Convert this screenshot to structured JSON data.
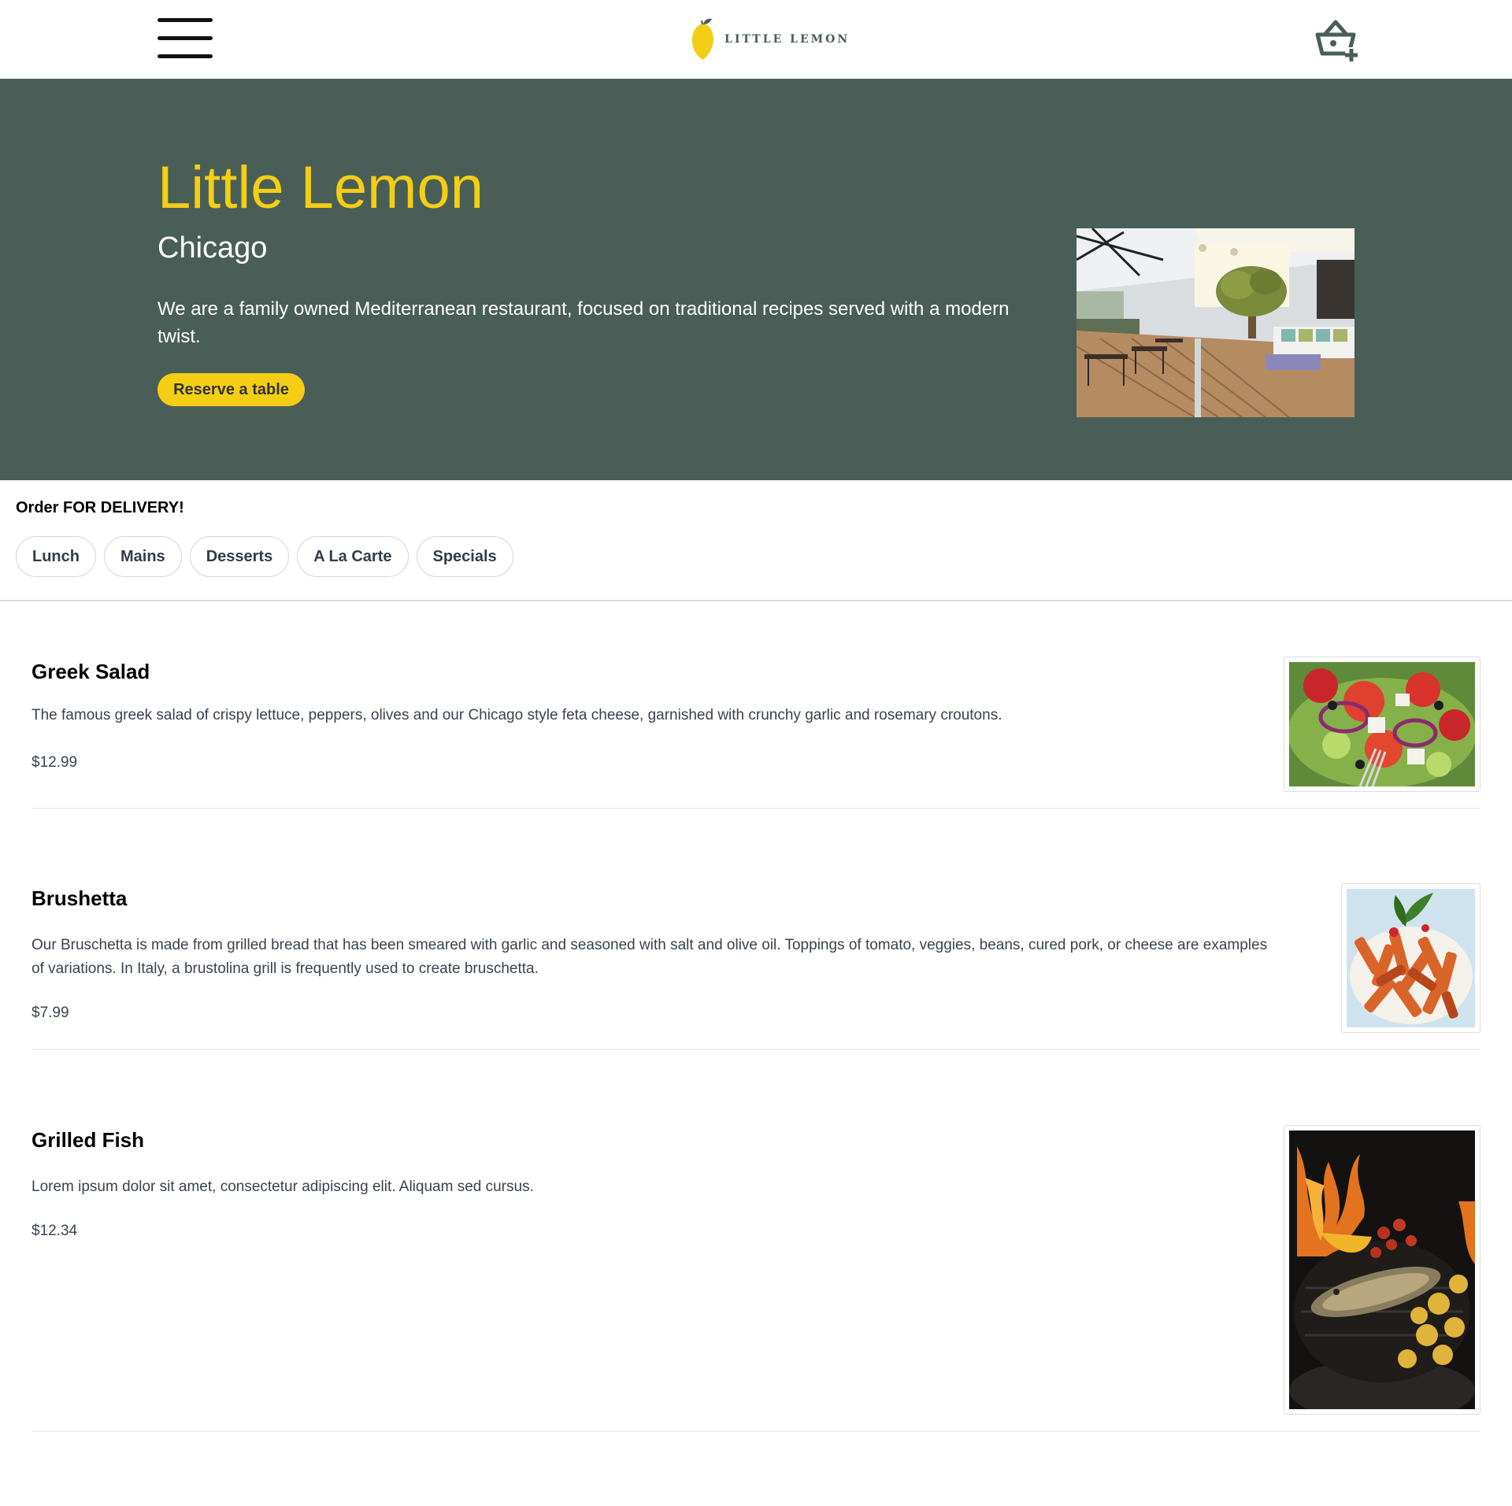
{
  "brand": {
    "logo_text": "LITTLE LEMON"
  },
  "hero": {
    "title": "Little Lemon",
    "subtitle": "Chicago",
    "description": "We are a family owned Mediterranean restaurant, focused on traditional recipes served with a modern twist.",
    "reserve_label": "Reserve a table"
  },
  "delivery": {
    "title": "Order FOR DELIVERY!",
    "categories": [
      "Lunch",
      "Mains",
      "Desserts",
      "A La Carte",
      "Specials"
    ]
  },
  "menu": [
    {
      "name": "Greek Salad",
      "description": "The famous greek salad of crispy lettuce, peppers, olives and our Chicago style feta cheese, garnished with crunchy garlic and rosemary croutons.",
      "price": "$12.99"
    },
    {
      "name": "Brushetta",
      "description": "Our Bruschetta is made from grilled bread that has been smeared with garlic and seasoned with salt and olive oil. Toppings of tomato, veggies, beans, cured pork, or cheese are examples of variations. In Italy, a brustolina grill is frequently used to create bruschetta.",
      "price": "$7.99"
    },
    {
      "name": "Grilled Fish",
      "description": "Lorem ipsum dolor sit amet, consectetur adipiscing elit. Aliquam sed cursus.",
      "price": "$12.34"
    }
  ],
  "colors": {
    "primary_green": "#495E57",
    "primary_yellow": "#F4CE14",
    "text_dark": "#333333"
  },
  "icons": {
    "menu": "hamburger-menu-icon",
    "cart": "basket-add-icon",
    "logo": "lemon-logo-icon"
  }
}
